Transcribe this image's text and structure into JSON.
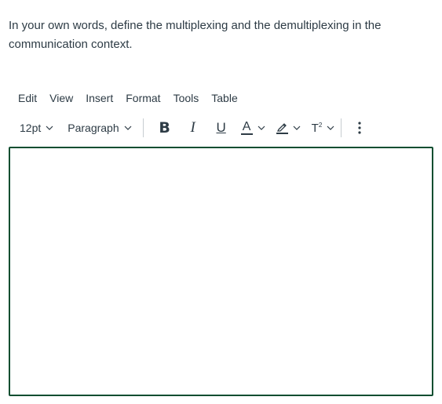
{
  "question": {
    "text": "In your own words, define the multiplexing and the demultiplexing in the communication context."
  },
  "menubar": {
    "items": [
      "Edit",
      "View",
      "Insert",
      "Format",
      "Tools",
      "Table"
    ]
  },
  "toolbar": {
    "font_size": "12pt",
    "block_format": "Paragraph",
    "bold_label": "B",
    "italic_label": "I",
    "underline_label": "U",
    "font_color_label": "A",
    "superscript_label": "T",
    "superscript_mark": "2",
    "text_color_underline": "#2d3b45",
    "highlight_underline": "#2d3b45",
    "icons": [
      "chevron-down-icon",
      "highlighter-icon",
      "more-vertical-icon"
    ]
  },
  "editor": {
    "content": "",
    "border_color": "#0b4e30"
  }
}
